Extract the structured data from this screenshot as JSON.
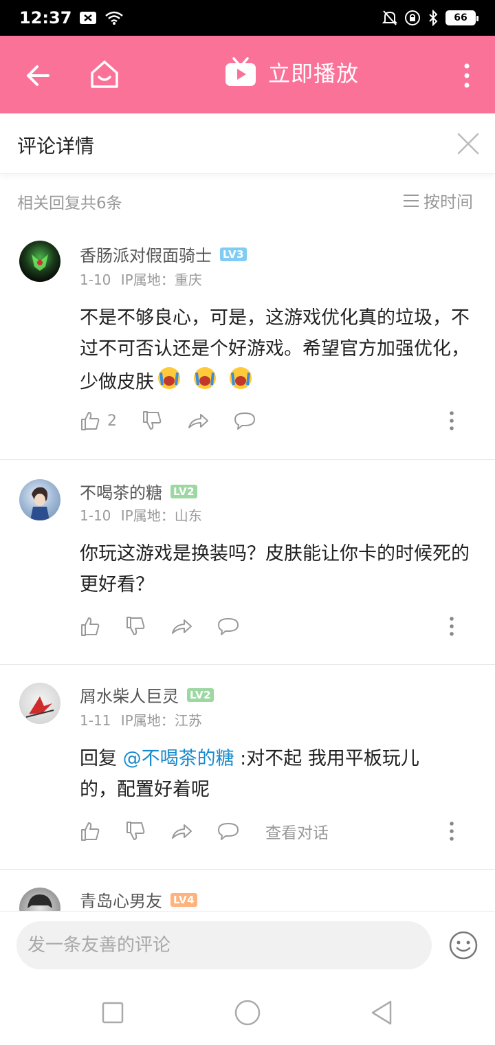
{
  "status": {
    "time": "12:37",
    "battery": "66"
  },
  "app_bar": {
    "title": "立即播放"
  },
  "detail": {
    "title": "评论详情"
  },
  "replies": {
    "count_text": "相关回复共6条",
    "sort_label": "按时间"
  },
  "comments": [
    {
      "username": "香肠派对假面骑士",
      "level": "LV3",
      "level_color": "#7fcdf5",
      "date": "1-10",
      "location": "IP属地：重庆",
      "content": "不是不够良心，可是，这游戏优化真的垃圾，不过不可否认还是个好游戏。希望官方加强优化，少做皮肤",
      "likes": "2"
    },
    {
      "username": "不喝茶的糖",
      "level": "LV2",
      "level_color": "#9dd8a3",
      "date": "1-10",
      "location": "IP属地：山东",
      "content": "你玩这游戏是换装吗？皮肤能让你卡的时候死的更好看？",
      "likes": ""
    },
    {
      "username": "屑水柴人巨灵",
      "level": "LV2",
      "level_color": "#9dd8a3",
      "date": "1-11",
      "location": "IP属地：江苏",
      "reply_prefix": "回复 ",
      "mention": "@不喝茶的糖",
      "content": " :对不起 我用平板玩儿的，配置好着呢",
      "view_conversation": "查看对话"
    },
    {
      "username": "青岛心男友",
      "level": "LV4",
      "level_color": "#ffb37c"
    }
  ],
  "composer": {
    "placeholder": "发一条友善的评论"
  },
  "colors": {
    "brand_pink": "#fb7299",
    "mention_blue": "#178bcf"
  },
  "icons": [
    "back-icon",
    "home-icon",
    "tv-play-icon",
    "more-vert-icon",
    "close-icon",
    "sort-icon",
    "like-icon",
    "dislike-icon",
    "share-icon",
    "reply-icon",
    "emoji-icon",
    "nav-square-icon",
    "nav-circle-icon",
    "nav-triangle-icon"
  ]
}
